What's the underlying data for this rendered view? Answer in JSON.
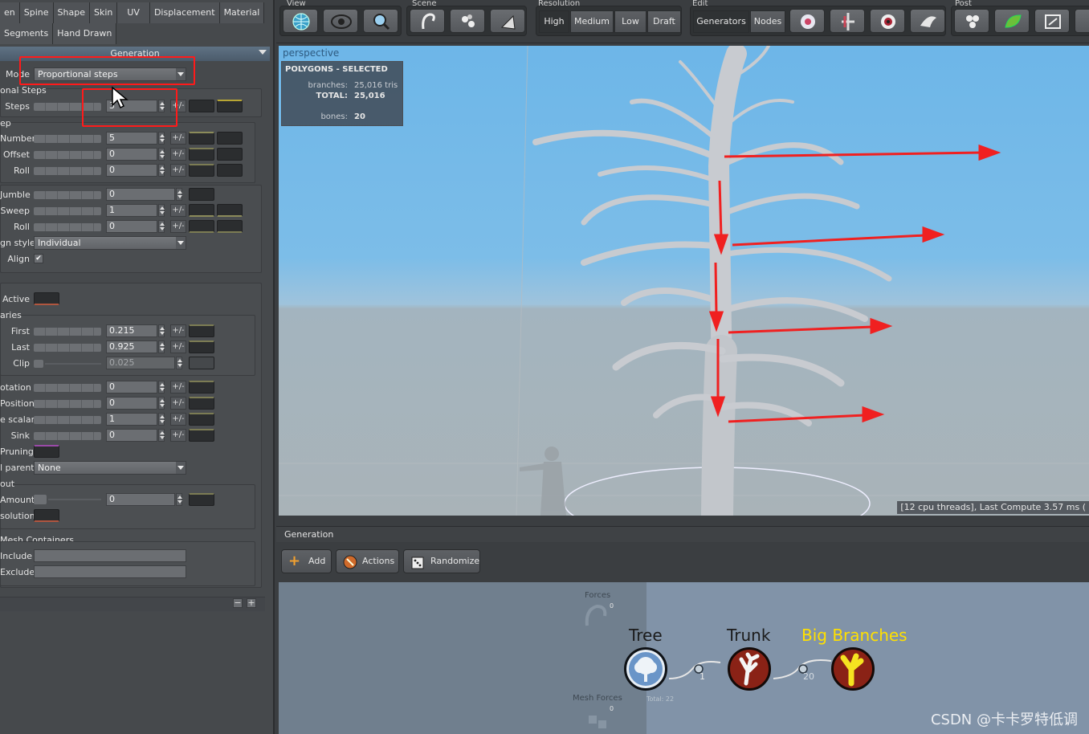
{
  "left_panel": {
    "tabs_row1": [
      "en",
      "Spine",
      "Shape",
      "Skin",
      "UV",
      "Displacement",
      "Material"
    ],
    "tabs_row2": [
      "Segments",
      "Hand Drawn"
    ],
    "section_header": "Generation",
    "mode": {
      "label": "Mode",
      "value": "Proportional steps"
    },
    "group_proportional": {
      "title": "onal Steps",
      "steps_label": "Steps",
      "steps_value": "3"
    },
    "group_step": {
      "title": "ep",
      "rows": [
        {
          "label": "Number",
          "value": "5"
        },
        {
          "label": "Offset",
          "value": "0"
        },
        {
          "label": "Roll",
          "value": "0"
        }
      ]
    },
    "rows_mid": [
      {
        "label": "Jumble",
        "value": "0"
      },
      {
        "label": "Sweep",
        "value": "1"
      },
      {
        "label": "Roll",
        "value": "0"
      }
    ],
    "align_style": {
      "label": "gn style",
      "value": "Individual"
    },
    "align": {
      "label": "Align",
      "checked": "✔"
    },
    "active_label": "Active",
    "group_boundaries": {
      "title": "aries",
      "rows": [
        {
          "label": "First",
          "value": "0.215"
        },
        {
          "label": "Last",
          "value": "0.925"
        },
        {
          "label": "Clip",
          "value": "0.025"
        }
      ]
    },
    "rows_lower": [
      {
        "label": "otation",
        "value": "0"
      },
      {
        "label": "Position",
        "value": "0"
      },
      {
        "label": "e scalar",
        "value": "1"
      },
      {
        "label": "Sink",
        "value": "0"
      }
    ],
    "pruning_label": "Pruning",
    "parent": {
      "label": "l parent",
      "value": "None"
    },
    "group_out": {
      "title": "out",
      "amount_label": "Amount",
      "amount_value": "0",
      "resolution_label": "solution"
    },
    "mesh_containers": {
      "title": "Mesh Containers",
      "include_label": "Include",
      "exclude_label": "Exclude"
    },
    "plusminus_label": "+/-"
  },
  "toolbar": {
    "groups": [
      {
        "label": "View",
        "icons": [
          "globe-icon",
          "eye-icon",
          "magnify-icon"
        ]
      },
      {
        "label": "Scene",
        "icons": [
          "hook-icon",
          "molecule-icon",
          "funnel-icon"
        ]
      },
      {
        "label": "Resolution",
        "buttons": [
          "High",
          "Medium",
          "Low",
          "Draft"
        ]
      },
      {
        "label": "Edit",
        "buttons": [
          "Generators",
          "Nodes"
        ],
        "icons": [
          "flower-icon",
          "add-node-icon",
          "target-icon",
          "bird-icon"
        ]
      },
      {
        "label": "Post",
        "icons": [
          "cluster-icon",
          "leaf-icon",
          "export-icon"
        ]
      }
    ]
  },
  "viewport": {
    "label": "perspective",
    "stats_title": "POLYGONS - SELECTED",
    "branches_label": "branches:",
    "branches_value": "25,016 tris",
    "total_label": "TOTAL:",
    "total_value": "25,016",
    "bones_label": "bones:",
    "bones_value": "20",
    "status": "[12 cpu threads], Last Compute 3.57 ms ("
  },
  "generation_panel": {
    "header": "Generation",
    "add_label": "Add",
    "actions_label": "Actions",
    "randomize_label": "Randomize"
  },
  "graph": {
    "forces_label": "Forces",
    "forces_count": "0",
    "mesh_forces_label": "Mesh Forces",
    "mesh_forces_count": "0",
    "total_label": "Total: 22",
    "nodes": [
      {
        "title": "Tree",
        "color": "#6a95c8"
      },
      {
        "title": "Trunk",
        "color": "#8a2216"
      },
      {
        "title": "Big Branches",
        "color": "#e4c71a"
      }
    ],
    "link1_count": "1",
    "link2_count": "20"
  },
  "watermark": "CSDN @卡卡罗特低调",
  "colors": {
    "highlight_red": "#ff1a1a",
    "arrow_red": "#f02020",
    "title_yellow": "#ffe000"
  }
}
